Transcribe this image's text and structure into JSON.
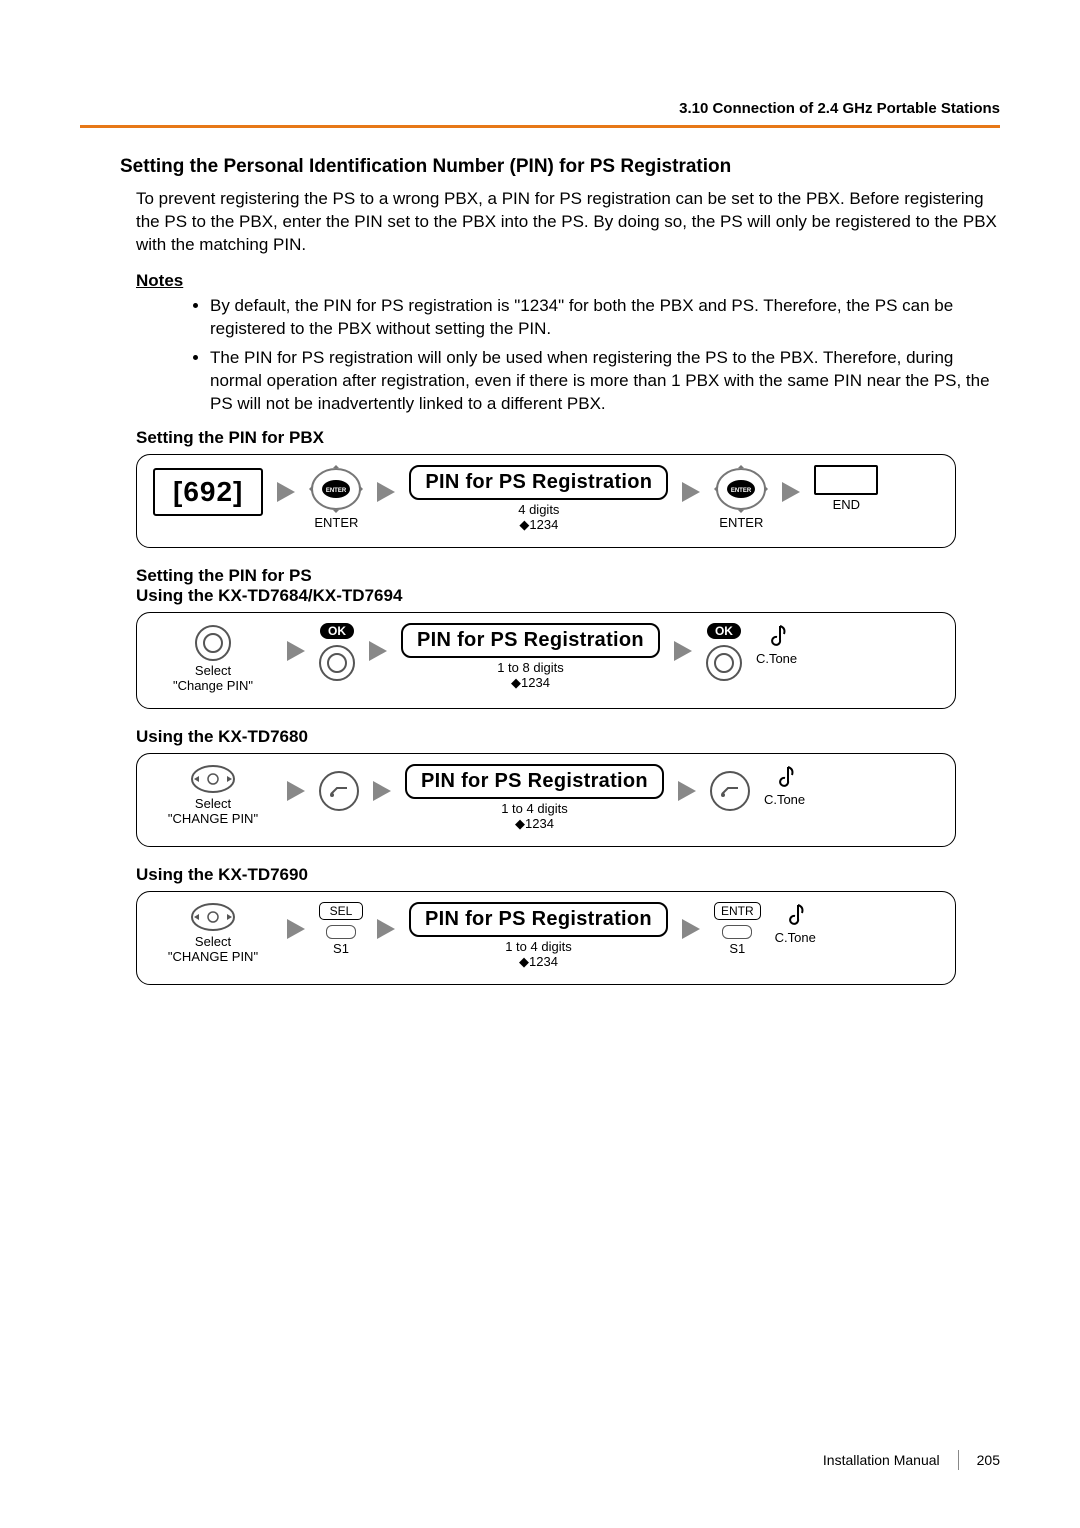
{
  "header": {
    "breadcrumb": "3.10 Connection of 2.4 GHz Portable Stations"
  },
  "section_title": "Setting the Personal Identification Number (PIN) for PS Registration",
  "intro": "To prevent registering the PS to a wrong PBX, a PIN for PS registration can be set to the PBX. Before registering the PS to the PBX, enter the PIN set to the PBX into the PS. By doing so, the PS will only be registered to the PBX with the matching PIN.",
  "notes_heading": "Notes",
  "notes": [
    "By default, the PIN for PS registration is \"1234\" for both the PBX and PS. Therefore, the PS can be registered to the PBX without setting the PIN.",
    "The PIN for PS registration will only be used when registering the PS to the PBX. Therefore, during normal operation after registration, even if there is more than 1 PBX with the same PIN near the PS, the PS will not be inadvertently linked to a different PBX."
  ],
  "pbx_heading": "Setting the PIN for PBX",
  "ps_heading_line1": "Setting the PIN for PS",
  "ps_heading_line2": "Using the KX-TD7684/KX-TD7694",
  "td7680_heading": "Using the KX-TD7680",
  "td7690_heading": "Using the KX-TD7690",
  "diagrams": {
    "pbx": {
      "code": "[692]",
      "enter": "ENTER",
      "pin_label": "PIN for PS Registration",
      "digits": "4 digits",
      "default": "◆1234",
      "end": "END"
    },
    "ps7684": {
      "select": "Select",
      "select_option": "\"Change PIN\"",
      "ok": "OK",
      "pin_label": "PIN for PS Registration",
      "digits": "1 to 8 digits",
      "default": "◆1234",
      "ctone": "C.Tone"
    },
    "td7680": {
      "select": "Select",
      "select_option": "\"CHANGE PIN\"",
      "pin_label": "PIN for PS Registration",
      "digits": "1 to 4 digits",
      "default": "◆1234",
      "ctone": "C.Tone"
    },
    "td7690": {
      "select": "Select",
      "select_option": "\"CHANGE PIN\"",
      "sel": "SEL",
      "entr": "ENTR",
      "s1": "S1",
      "pin_label": "PIN for PS Registration",
      "digits": "1 to 4 digits",
      "default": "◆1234",
      "ctone": "C.Tone"
    }
  },
  "footer": {
    "manual": "Installation Manual",
    "page": "205"
  }
}
